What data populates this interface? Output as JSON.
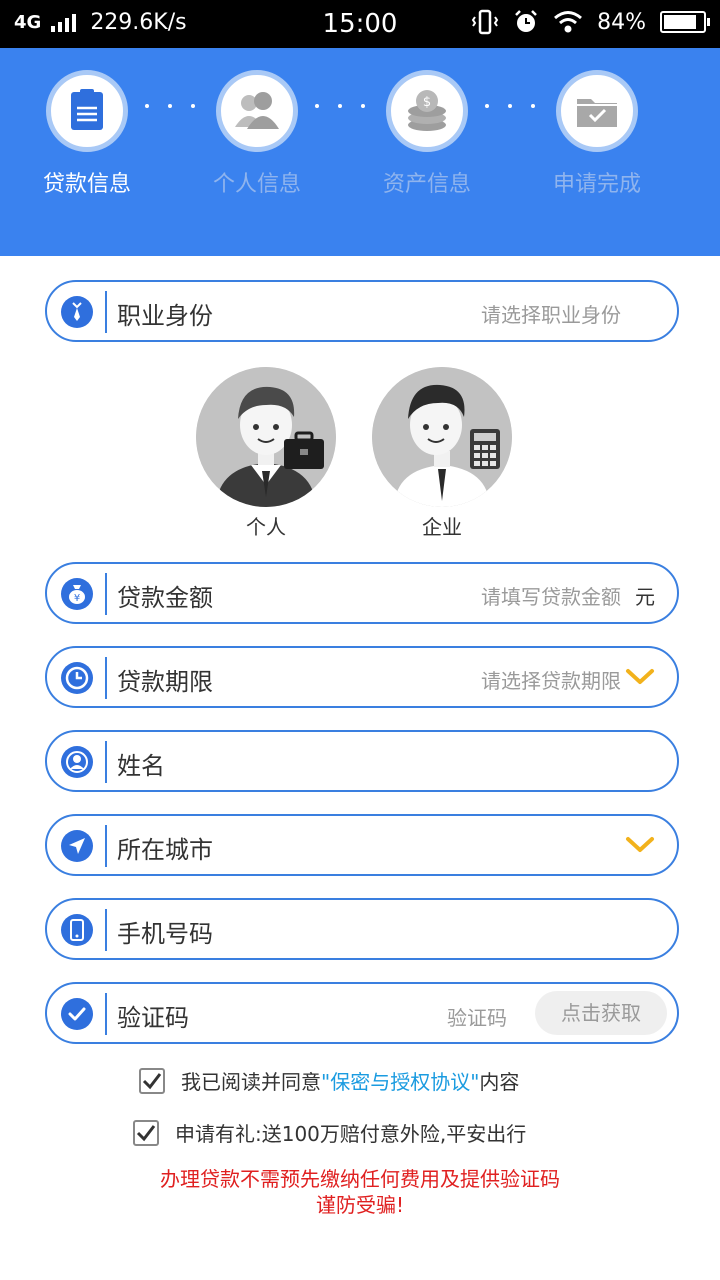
{
  "status_bar": {
    "network": "4G",
    "speed": "229.6K/s",
    "time": "15:00",
    "battery": "84%",
    "battery_level": 0.84
  },
  "steps": [
    {
      "label": "贷款信息",
      "icon": "document-icon",
      "active": true
    },
    {
      "label": "个人信息",
      "icon": "users-icon",
      "active": false
    },
    {
      "label": "资产信息",
      "icon": "coins-icon",
      "active": false
    },
    {
      "label": "申请完成",
      "icon": "folder-check-icon",
      "active": false
    }
  ],
  "form": {
    "occupation": {
      "label": "职业身份",
      "placeholder": "请选择职业身份",
      "icon": "tie-icon"
    },
    "identity_options": [
      {
        "label": "个人",
        "icon": "individual-avatar"
      },
      {
        "label": "企业",
        "icon": "business-avatar"
      }
    ],
    "amount": {
      "label": "贷款金额",
      "placeholder": "请填写贷款金额",
      "unit": "元",
      "icon": "money-bag-icon"
    },
    "term": {
      "label": "贷款期限",
      "placeholder": "请选择贷款期限",
      "icon": "clock-icon"
    },
    "name": {
      "label": "姓名",
      "icon": "user-icon"
    },
    "city": {
      "label": "所在城市",
      "icon": "location-arrow-icon"
    },
    "phone": {
      "label": "手机号码",
      "icon": "phone-icon"
    },
    "code": {
      "label": "验证码",
      "placeholder": "验证码",
      "button": "点击获取",
      "icon": "check-circle-icon"
    }
  },
  "agreement": {
    "prefix": "我已阅读并同意",
    "link": "\"保密与授权协议\"",
    "suffix": "内容",
    "checked": true
  },
  "gift": {
    "text": "申请有礼:送100万赔付意外险,平安出行",
    "checked": true
  },
  "warning": {
    "line1": "办理贷款不需预先缴纳任何费用及提供验证码",
    "line2": "谨防受骗!"
  },
  "colors": {
    "primary": "#3a82ef",
    "accent_chevron": "#f2b21c",
    "link": "#1a9be0",
    "warning": "#e02020"
  }
}
